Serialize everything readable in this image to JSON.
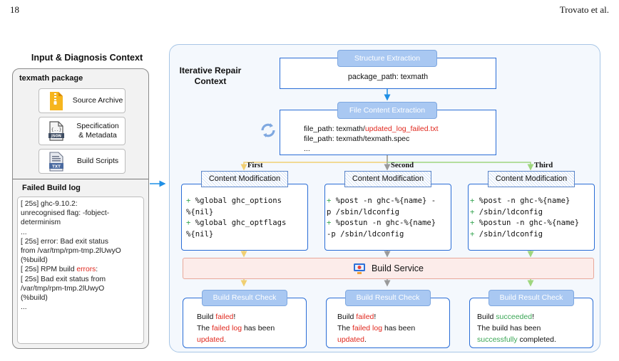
{
  "header": {
    "page_number": "18",
    "author": "Trovato et al."
  },
  "left_panel": {
    "title": "Input & Diagnosis Context",
    "package_title": "texmath package",
    "items": [
      {
        "label": "Source Archive",
        "icon": "zip-file-icon"
      },
      {
        "label_line1": "Specification",
        "label_line2": "& Metadata",
        "icon": "json-file-icon"
      },
      {
        "label": "Build Scripts",
        "icon": "txt-file-icon"
      }
    ],
    "log_title": "Failed Build log",
    "log": {
      "l1": "[   25s] ghc-9.10.2:",
      "l2": "unrecognised flag: -fobject-",
      "l3": "determinism",
      "l4": "...",
      "l5": "[   25s] error: Bad exit status",
      "l6": "from /var/tmp/rpm-tmp.2lUwyO",
      "l7": "(%build)",
      "l8_pre": "[   25s] RPM build ",
      "l8_red": "errors",
      "l8_post": ":",
      "l9": "[   25s] Bad exit status from",
      "l10": "/var/tmp/rpm-tmp.2lUwyO",
      "l11": "(%build)",
      "l12": "..."
    }
  },
  "right_panel": {
    "title_line1": "Iterative Repair",
    "title_line2": "Context",
    "structure": {
      "label": "Structure Extraction",
      "path": "package_path: texmath"
    },
    "file_content": {
      "label": "File Content Extraction",
      "line1_pre": "file_path: texmath/",
      "line1_red": "updated_log_failed.txt",
      "line2": "file_path: texmath/texmath.spec",
      "line3": "..."
    },
    "iterations": [
      "First",
      "Second",
      "Third"
    ],
    "modification_label": "Content Modification",
    "mods": [
      [
        "%global ghc_options",
        "%{nil}",
        "%global ghc_optflags",
        "%{nil}"
      ],
      [
        "%post -n ghc-%{name} -",
        "p /sbin/ldconfig",
        "%postun -n ghc-%{name}",
        "-p /sbin/ldconfig"
      ],
      [
        "%post -n ghc-%{name}",
        "/sbin/ldconfig",
        "%postun -n ghc-%{name}",
        "/sbin/ldconfig"
      ]
    ],
    "build_service": "Build Service",
    "result_label": "Build Result Check",
    "results": [
      {
        "build": "Build ",
        "status": "failed",
        "bang": "!",
        "l2_pre": "The ",
        "l2_color": "failed log",
        "l2_post": " has been",
        "l3": "updated",
        "l3_post": "."
      },
      {
        "build": "Build ",
        "status": "failed",
        "bang": "!",
        "l2_pre": "The ",
        "l2_color": "failed log",
        "l2_post": " has been",
        "l3": "updated",
        "l3_post": "."
      },
      {
        "build": "Build ",
        "status": "succeeded",
        "bang": "!",
        "l2_pre": "The build has been",
        "l3": "successfully",
        "l3_post": " completed."
      }
    ]
  },
  "colors": {
    "accent_blue": "#2a6dd6",
    "arrow_blue": "#1f8fe5",
    "red": "#e0281e",
    "green": "#3aa655",
    "first_arrow": "#f0cf73",
    "second_arrow": "#9a9a9a",
    "third_arrow": "#9fd67f"
  }
}
